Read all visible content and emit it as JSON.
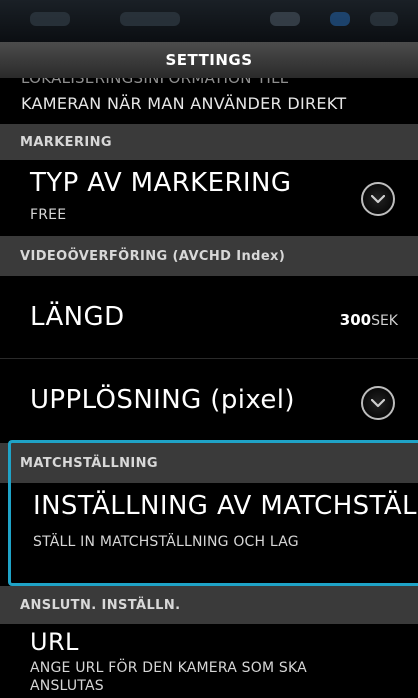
{
  "header": {
    "title": "SETTINGS"
  },
  "clipped_item": {
    "line1": "LOKALISERINGSINFORMATION TILL",
    "line2": "KAMERAN NÄR MAN ANVÄNDER DIREKT"
  },
  "sections": {
    "markering": "MARKERING",
    "videooverforing": "VIDEOÖVERFÖRING (AVCHD Index)",
    "matchstallning": "MATCHSTÄLLNING",
    "anslutn": "ANSLUTN. INSTÄLLN."
  },
  "items": {
    "typ": {
      "label": "TYP AV MARKERING",
      "sub": "FREE",
      "icon": "chevron-down-icon"
    },
    "langd": {
      "label": "LÄNGD",
      "value": "300",
      "unit": "SEK"
    },
    "upplosning": {
      "label": "UPPLÖSNING (pixel)",
      "icon": "chevron-down-icon"
    },
    "matchstallning": {
      "label": "INSTÄLLNING AV MATCHSTÄLLNING",
      "sub": "STÄLL IN MATCHSTÄLLNING OCH LAG"
    },
    "url": {
      "label": "URL",
      "sub1": "ANGE URL FÖR DEN KAMERA SOM SKA",
      "sub2": "ANSLUTAS"
    }
  },
  "colors": {
    "highlight": "#1fa3c7",
    "section_bg": "#3a3a3a"
  }
}
